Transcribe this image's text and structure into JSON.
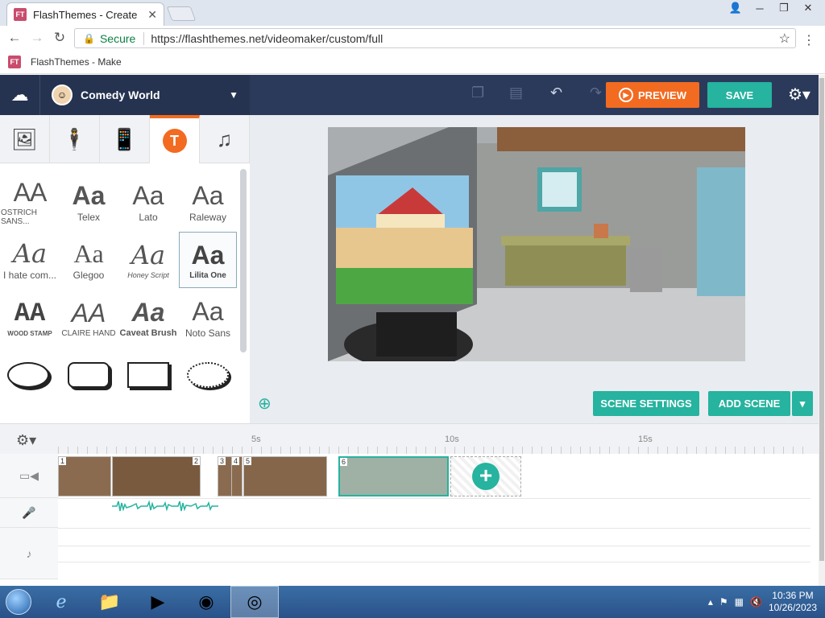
{
  "browser": {
    "tab_title": "FlashThemes - Create",
    "favicon_text": "FT",
    "secure_label": "Secure",
    "url": "https://flashthemes.net/videomaker/custom/full",
    "bookmark_label": "FlashThemes - Make"
  },
  "header": {
    "theme_name": "Comedy World",
    "preview_label": "PREVIEW",
    "save_label": "SAVE"
  },
  "left_tabs": [
    "image-icon",
    "character-icon",
    "phone-icon",
    "text-icon",
    "music-icon"
  ],
  "fonts": [
    {
      "sample": "AA",
      "name": "OSTRICH SANS..."
    },
    {
      "sample": "Aa",
      "name": "Telex"
    },
    {
      "sample": "Aa",
      "name": "Lato"
    },
    {
      "sample": "Aa",
      "name": "Raleway"
    },
    {
      "sample": "Aa",
      "name": "I hate com..."
    },
    {
      "sample": "Aa",
      "name": "Glegoo"
    },
    {
      "sample": "Aa",
      "name": "Honey Script"
    },
    {
      "sample": "Aa",
      "name": "Lilita One"
    },
    {
      "sample": "AA",
      "name": "WOOD STAMP"
    },
    {
      "sample": "AA",
      "name": "CLAIRE HAND"
    },
    {
      "sample": "Aa",
      "name": "Caveat Brush"
    },
    {
      "sample": "Aa",
      "name": "Noto Sans"
    }
  ],
  "stage": {
    "scene_settings_label": "SCENE SETTINGS",
    "add_scene_label": "ADD SCENE"
  },
  "timeline": {
    "ticks": [
      "5s",
      "10s",
      "15s"
    ],
    "clips": [
      "1",
      "2",
      "3",
      "4",
      "5",
      "6"
    ],
    "selected_clip": "6"
  },
  "taskbar": {
    "time": "10:36 PM",
    "date": "10/26/2023"
  },
  "colors": {
    "accent_orange": "#f26b21",
    "accent_teal": "#26b39f",
    "header_navy": "#2b3a5a"
  }
}
